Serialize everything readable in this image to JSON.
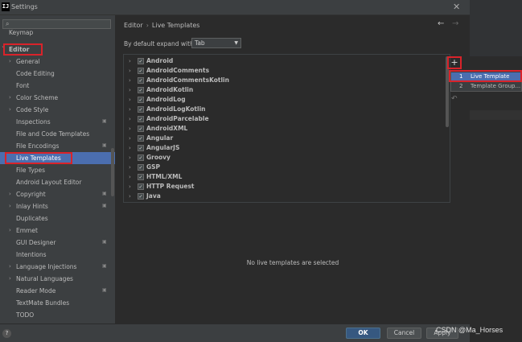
{
  "window": {
    "title": "Settings",
    "app_icon_letter": "IJ"
  },
  "search": {
    "placeholder": ""
  },
  "sidebar": {
    "items": [
      {
        "label": "Keymap",
        "top": true,
        "arrow": "",
        "badge": false
      },
      {
        "label": "Editor",
        "top": true,
        "arrow": "˅",
        "badge": false
      },
      {
        "label": "General",
        "arrow": "›",
        "badge": false
      },
      {
        "label": "Code Editing",
        "arrow": "",
        "badge": false
      },
      {
        "label": "Font",
        "arrow": "",
        "badge": false
      },
      {
        "label": "Color Scheme",
        "arrow": "›",
        "badge": false
      },
      {
        "label": "Code Style",
        "arrow": "›",
        "badge": false
      },
      {
        "label": "Inspections",
        "arrow": "",
        "badge": true
      },
      {
        "label": "File and Code Templates",
        "arrow": "",
        "badge": false
      },
      {
        "label": "File Encodings",
        "arrow": "",
        "badge": true
      },
      {
        "label": "Live Templates",
        "arrow": "",
        "badge": false,
        "selected": true
      },
      {
        "label": "File Types",
        "arrow": "",
        "badge": false
      },
      {
        "label": "Android Layout Editor",
        "arrow": "",
        "badge": false
      },
      {
        "label": "Copyright",
        "arrow": "›",
        "badge": true
      },
      {
        "label": "Inlay Hints",
        "arrow": "›",
        "badge": true
      },
      {
        "label": "Duplicates",
        "arrow": "",
        "badge": false
      },
      {
        "label": "Emmet",
        "arrow": "›",
        "badge": false
      },
      {
        "label": "GUI Designer",
        "arrow": "",
        "badge": true
      },
      {
        "label": "Intentions",
        "arrow": "",
        "badge": false
      },
      {
        "label": "Language Injections",
        "arrow": "›",
        "badge": true
      },
      {
        "label": "Natural Languages",
        "arrow": "›",
        "badge": false
      },
      {
        "label": "Reader Mode",
        "arrow": "",
        "badge": true
      },
      {
        "label": "TextMate Bundles",
        "arrow": "",
        "badge": false
      },
      {
        "label": "TODO",
        "arrow": "",
        "badge": false
      }
    ]
  },
  "breadcrumb": {
    "parent": "Editor",
    "separator": "›",
    "current": "Live Templates"
  },
  "nav": {
    "back": "←",
    "forward": "→"
  },
  "expand": {
    "label": "By default expand with",
    "value": "Tab"
  },
  "template_groups": [
    "Android",
    "AndroidComments",
    "AndroidCommentsKotlin",
    "AndroidKotlin",
    "AndroidLog",
    "AndroidLogKotlin",
    "AndroidParcelable",
    "AndroidXML",
    "Angular",
    "AngularJS",
    "Groovy",
    "GSP",
    "HTML/XML",
    "HTTP Request",
    "Java"
  ],
  "toolbar": {
    "add": "+",
    "undo": "↶"
  },
  "popup": {
    "items": [
      {
        "mnemonic": "1",
        "label": "Live Template",
        "selected": true
      },
      {
        "mnemonic": "2",
        "label": "Template Group..."
      }
    ]
  },
  "empty_message": "No live templates are selected",
  "buttons": {
    "help": "?",
    "ok": "OK",
    "cancel": "Cancel",
    "apply": "Apply"
  },
  "watermark": "CSDN @Ma_Horses",
  "colors": {
    "accent": "#4b6eaf",
    "highlight": "#d9232a",
    "ok_button": "#365880"
  }
}
